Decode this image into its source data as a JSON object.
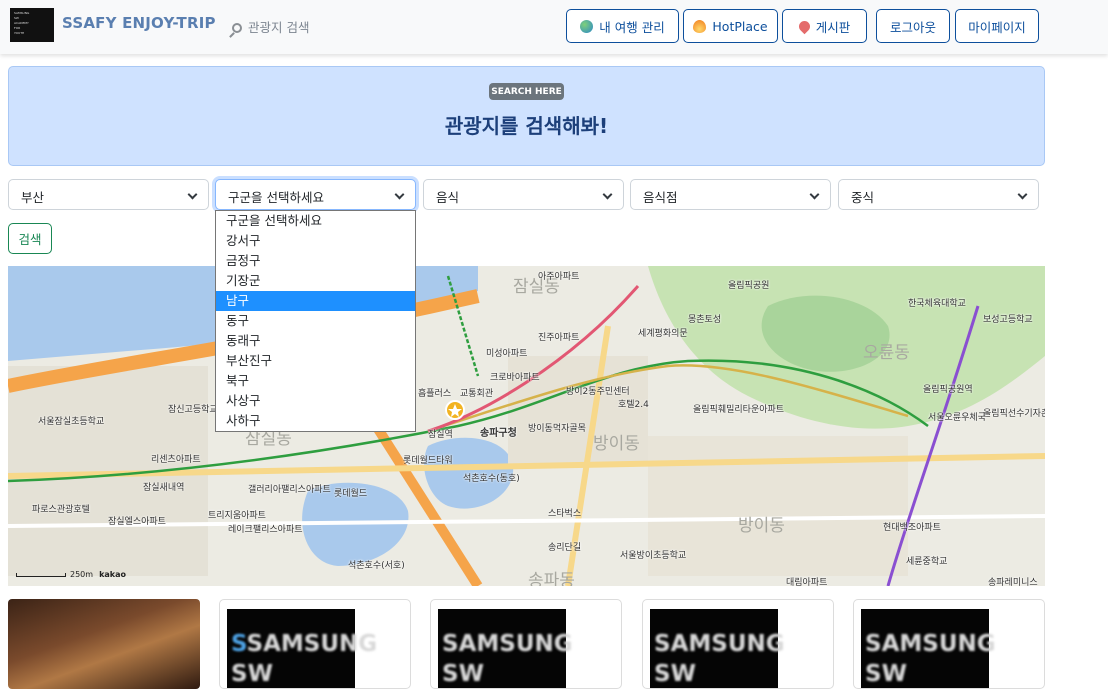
{
  "navbar": {
    "brand": "SSAFY ENJOY-TRIP",
    "logo_lines": [
      "SAMSUNG",
      "SW",
      "ACADEMY",
      "FOR",
      "YOUTH"
    ],
    "search_link": "관광지 검색",
    "buttons": [
      {
        "label": "내 여행 관리",
        "icon": "globe-icon"
      },
      {
        "label": "HotPlace",
        "icon": "fire-icon"
      },
      {
        "label": "게시판",
        "icon": "pushpin-icon"
      },
      {
        "label": "로그아웃"
      },
      {
        "label": "마이페이지"
      }
    ]
  },
  "hero": {
    "badge": "SEARCH HERE",
    "title": "관광지를 검색해봐!"
  },
  "filters": {
    "sido": "부산",
    "gugun": "구군을 선택하세요",
    "category": "음식",
    "subcategory": "음식점",
    "type": "중식",
    "search_button": "검색"
  },
  "gugun_options": [
    "구군을 선택하세요",
    "강서구",
    "금정구",
    "기장군",
    "남구",
    "동구",
    "동래구",
    "부산진구",
    "북구",
    "사상구",
    "사하구"
  ],
  "gugun_highlighted": "남구",
  "map": {
    "labels": [
      "잠실동",
      "잠실동",
      "방이동",
      "방이동",
      "오륜동",
      "송파동",
      "잠실역",
      "송파구청",
      "롯데월드타워",
      "롯데월드",
      "석촌호수(동호)",
      "석촌호수(서호)",
      "올림픽공원",
      "올림픽공원역",
      "한국체육대학교",
      "서울잠실초등학교",
      "잠신고등학교",
      "리센츠아파트",
      "갤러리아팰리스아파트",
      "트리지움아파트",
      "레이크팰리스아파트",
      "잠실엘스아파트",
      "파로스관광호텔",
      "잠실새내역",
      "진주아파트",
      "미성아파트",
      "크로바아파트",
      "방이2동주민센터",
      "호텔2.4",
      "방이동먹자골목",
      "올림픽훼밀리타운아파트",
      "세계평화의문",
      "몽촌토성",
      "보성고등학교",
      "스타벅스",
      "송리단길",
      "서울방이초등학교",
      "대림아파트",
      "송파레미니스",
      "아주아파트",
      "교통회관",
      "흡플러스",
      "올림픽선수기자촌아파트",
      "서울오륜우체국",
      "현대백조아파트",
      "세륜중학교"
    ],
    "scale": "250m",
    "provider": "kakao"
  },
  "cards": [
    {
      "type": "photo"
    },
    {
      "type": "logo",
      "text_line1": "SAMSUNG",
      "text_line2": "SW"
    },
    {
      "type": "logo",
      "text_line1": "SAMSUNG",
      "text_line2": "SW"
    },
    {
      "type": "logo",
      "text_line1": "SAMSUNG",
      "text_line2": "SW"
    },
    {
      "type": "logo",
      "text_line1": "SAMSUNG",
      "text_line2": "SW"
    }
  ],
  "colors": {
    "accent": "#0d4f9c",
    "hero_bg": "#cfe2ff",
    "success": "#198754",
    "dropdown_highlight": "#1e90ff"
  }
}
